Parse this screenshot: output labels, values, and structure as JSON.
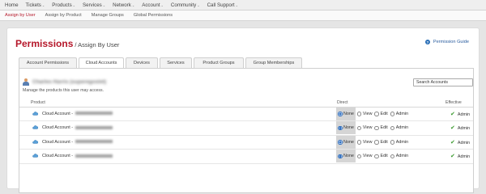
{
  "topnav": {
    "items": [
      {
        "label": "Home",
        "dropdown": false
      },
      {
        "label": "Tickets",
        "dropdown": true
      },
      {
        "label": "Products",
        "dropdown": true
      },
      {
        "label": "Services",
        "dropdown": true
      },
      {
        "label": "Network",
        "dropdown": true
      },
      {
        "label": "Account",
        "dropdown": true
      },
      {
        "label": "Community",
        "dropdown": true
      },
      {
        "label": "Call Support",
        "dropdown": true
      }
    ],
    "caret": "⌄"
  },
  "subnav": {
    "items": [
      {
        "label": "Assign by User",
        "active": true
      },
      {
        "label": "Assign by Product",
        "active": false
      },
      {
        "label": "Manage Groups",
        "active": false
      },
      {
        "label": "Global Permissions",
        "active": false
      }
    ]
  },
  "header": {
    "title": "Permissions",
    "subtitle": "/ Assign By User",
    "guide_label": "Permission Guide",
    "guide_icon": "?"
  },
  "tabs": [
    {
      "label": "Account Permissions",
      "active": false
    },
    {
      "label": "Cloud Accounts",
      "active": true
    },
    {
      "label": "Devices",
      "active": false
    },
    {
      "label": "Services",
      "active": false
    },
    {
      "label": "Product Groups",
      "active": false
    },
    {
      "label": "Group Memberships",
      "active": false
    }
  ],
  "user": {
    "name": "Charles Harris (superegoslet)",
    "description": "Manage the products this user may access."
  },
  "search": {
    "placeholder": "Search Accounts"
  },
  "table": {
    "columns": {
      "product": "Product",
      "direct": "Direct",
      "effective": "Effective"
    },
    "options": [
      "None",
      "View",
      "Edit",
      "Admin"
    ],
    "rows": [
      {
        "product_prefix": "Cloud Account -",
        "selected": "None",
        "effective": "Admin"
      },
      {
        "product_prefix": "Cloud Account -",
        "selected": "None",
        "effective": "Admin"
      },
      {
        "product_prefix": "Cloud Account -",
        "selected": "None",
        "effective": "Admin"
      },
      {
        "product_prefix": "Cloud Account -",
        "selected": "None",
        "effective": "Admin"
      }
    ]
  },
  "colors": {
    "accent_red": "#b5172a",
    "link_blue": "#2a5d9f",
    "radio_blue": "#2f6fc0",
    "check_green": "#3a9a2f"
  },
  "icons": {
    "help": "help-icon",
    "user": "user-avatar-icon",
    "cloud": "cloud-icon",
    "check": "checkmark-icon",
    "check_glyph": "✔"
  }
}
